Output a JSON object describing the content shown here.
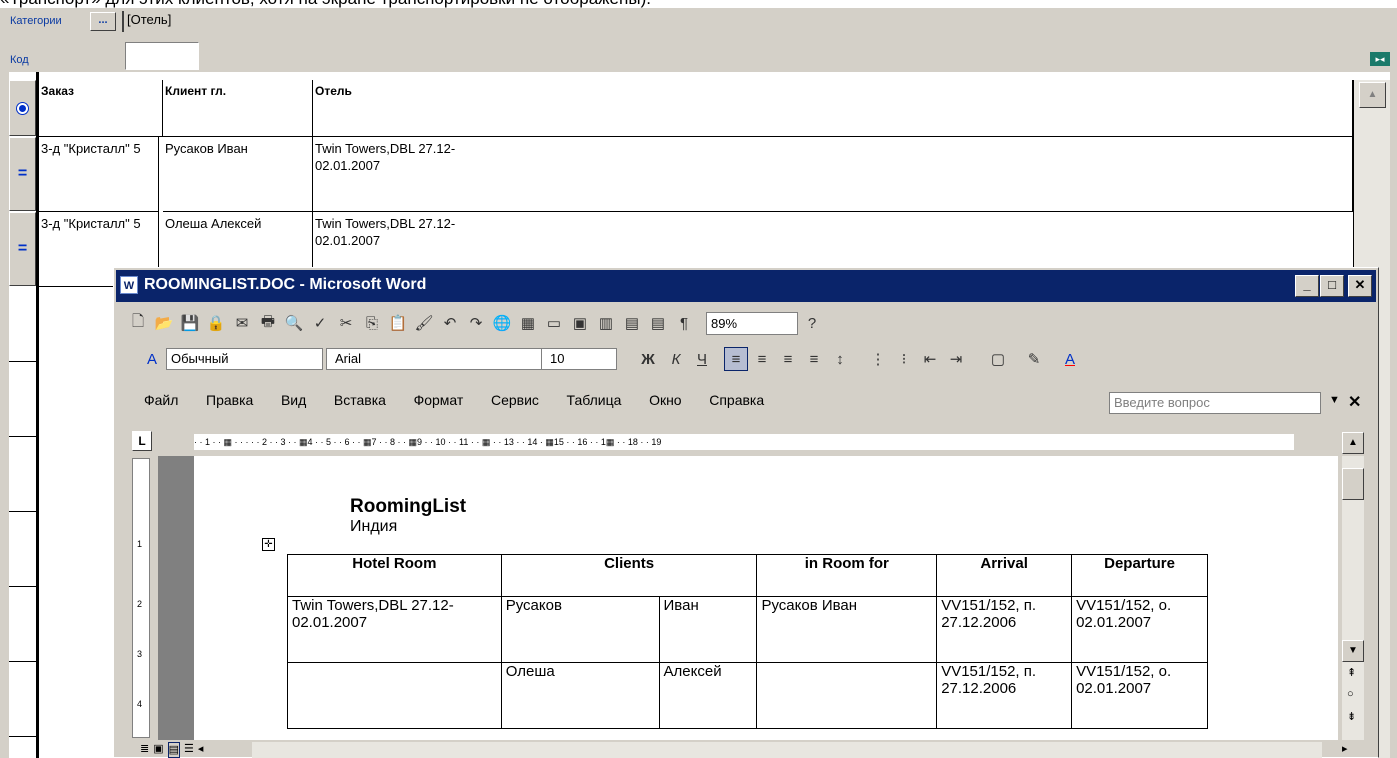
{
  "top_caption": "«Транспорт» для этих клиентов, хотя на экране транспортировки не отображены).",
  "filters": {
    "categories_label": "Категории",
    "categories_btn": "...",
    "categories_value": "[Отель]",
    "code_label": "Код",
    "code_value": ""
  },
  "grid": {
    "columns": [
      "Заказ",
      "Клиент гл.",
      "Отель"
    ],
    "rows": [
      {
        "order": "3-д \"Кристалл\" 5",
        "client": "Русаков Иван",
        "hotel": "Twin Towers,DBL 27.12-02.01.2007",
        "marker": "="
      },
      {
        "order": "3-д \"Кристалл\" 5",
        "client": "Олеша Алексей",
        "hotel": "Twin Towers,DBL 27.12-02.01.2007",
        "marker": "="
      }
    ]
  },
  "word": {
    "title": "ROOMINGLIST.DOC - Microsoft Word",
    "style": "Обычный",
    "font": "Arial",
    "size": "10",
    "zoom": "89%",
    "menu": [
      "Файл",
      "Правка",
      "Вид",
      "Вставка",
      "Формат",
      "Сервис",
      "Таблица",
      "Окно",
      "Справка"
    ],
    "ask": "Введите вопрос",
    "ruler": "· · 1 · · ▦ · · · · · 2 · · 3 · · ▦4 · · 5 · · 6 · · ▦7 · · 8 · · ▦9 · · 10 · · 11 · · ▦ · · 13 · · 14 · ▦15 · · 16 · · 1▦ · · 18 · · 19",
    "doc_title": "RoomingList",
    "doc_subtitle": "Индия",
    "table": {
      "headers": [
        "Hotel Room",
        "Clients",
        "in Room for",
        "Arrival",
        "Departure"
      ],
      "rows": [
        {
          "hotel": "Twin Towers,DBL 27.12-02.01.2007",
          "last": "Русаков",
          "first": "Иван",
          "room_for": "Русаков Иван",
          "arrival": "VV151/152, п. 27.12.2006",
          "departure": "VV151/152, о. 02.01.2007"
        },
        {
          "hotel": "",
          "last": "Олеша",
          "first": "Алексей",
          "room_for": "",
          "arrival": "VV151/152, п. 27.12.2006",
          "departure": "VV151/152, о. 02.01.2007"
        }
      ]
    }
  }
}
